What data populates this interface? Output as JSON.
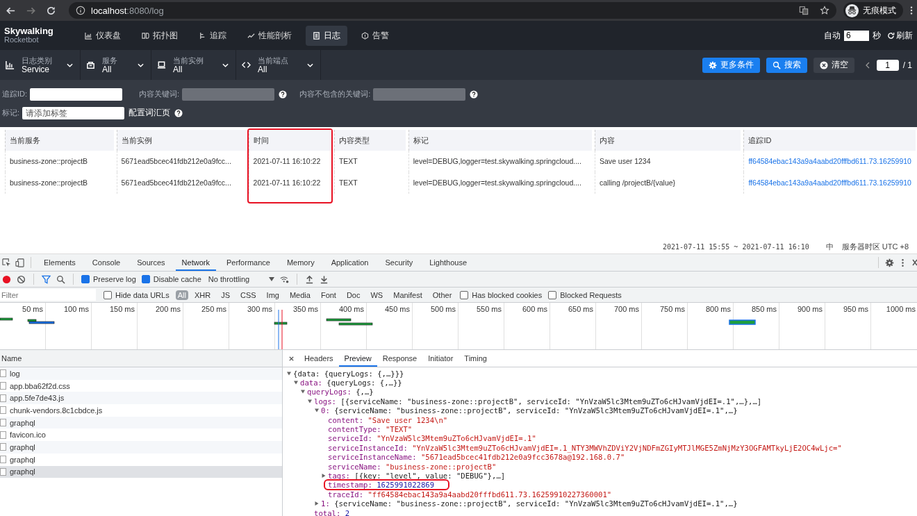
{
  "browser": {
    "url_host": "localhost",
    "url_path": ":8080/log",
    "profile": "无痕模式"
  },
  "app": {
    "logo": "Skywalking",
    "logo_sub": "Rocketbot",
    "nav": [
      {
        "label": "仪表盘",
        "selected": false
      },
      {
        "label": "拓扑图",
        "selected": false
      },
      {
        "label": "追踪",
        "selected": false
      },
      {
        "label": "性能剖析",
        "selected": false
      },
      {
        "label": "日志",
        "selected": true
      },
      {
        "label": "告警",
        "selected": false
      }
    ],
    "auto_label": "自动",
    "interval": "6",
    "interval_unit": "秒",
    "refresh": "刷新"
  },
  "toolbar": {
    "selectors": [
      {
        "label": "日志类别",
        "value": "Service"
      },
      {
        "label": "服务",
        "value": "All"
      },
      {
        "label": "当前实例",
        "value": "All"
      },
      {
        "label": "当前端点",
        "value": "All"
      }
    ],
    "buttons": [
      {
        "label": "更多条件",
        "kind": "primary"
      },
      {
        "label": "搜索",
        "kind": "primary"
      },
      {
        "label": "清空",
        "kind": "secondary"
      }
    ],
    "page": "1",
    "page_total": "/ 1"
  },
  "filters": {
    "fields": [
      {
        "label": "追踪ID:",
        "disabled": false,
        "help": false
      },
      {
        "label": "内容关键词:",
        "disabled": true,
        "help": true
      },
      {
        "label": "内容不包含的关键词:",
        "disabled": true,
        "help": true
      }
    ],
    "tags": {
      "label": "标记:",
      "placeholder": "请添加标签"
    },
    "vocab_link": "配置词汇页"
  },
  "table": {
    "columns": [
      {
        "label": "当前服务",
        "kind": "text",
        "highlighted": false
      },
      {
        "label": "当前实例",
        "kind": "text",
        "highlighted": false
      },
      {
        "label": "时间",
        "kind": "text",
        "highlighted": true
      },
      {
        "label": "内容类型",
        "kind": "text",
        "highlighted": false
      },
      {
        "label": "标记",
        "kind": "text",
        "highlighted": false
      },
      {
        "label": "内容",
        "kind": "text",
        "highlighted": false
      },
      {
        "label": "追踪ID",
        "kind": "link",
        "highlighted": false
      }
    ],
    "rows": [
      [
        "business-zone::projectB",
        "5671ead5bcec41fdb212e0a9fcc...",
        "2021-07-11 16:10:22",
        "TEXT",
        "level=DEBUG,logger=test.skywalking.springcloud....",
        "Save user 1234",
        "ff64584ebac143a9a4aabd20fffbd611.73.16259910"
      ],
      [
        "business-zone::projectB",
        "5671ead5bcec41fdb212e0a9fcc...",
        "2021-07-11 16:10:22",
        "TEXT",
        "level=DEBUG,logger=test.skywalking.springcloud....",
        "calling /projectB/{value}",
        "ff64584ebac143a9a4aabd20fffbd611.73.16259910"
      ]
    ]
  },
  "footer": {
    "time_range": "2021-07-11 15:55 ~ 2021-07-11 16:10",
    "language": "中",
    "timezone": "服务器时区 UTC +8"
  },
  "devtools": {
    "tabs": [
      {
        "label": "Elements",
        "selected": false
      },
      {
        "label": "Console",
        "selected": false
      },
      {
        "label": "Sources",
        "selected": false
      },
      {
        "label": "Network",
        "selected": true
      },
      {
        "label": "Performance",
        "selected": false
      },
      {
        "label": "Memory",
        "selected": false
      },
      {
        "label": "Application",
        "selected": false
      },
      {
        "label": "Security",
        "selected": false
      },
      {
        "label": "Lighthouse",
        "selected": false
      }
    ],
    "options": [
      {
        "label": "Preserve log",
        "checked": true
      },
      {
        "label": "Disable cache",
        "checked": true
      }
    ],
    "throttling": "No throttling",
    "filter_placeholder": "Filter",
    "hide_data_urls": {
      "label": "Hide data URLs",
      "checked": false
    },
    "types": [
      {
        "label": "All",
        "selected": true
      },
      {
        "label": "XHR",
        "selected": false
      },
      {
        "label": "JS",
        "selected": false
      },
      {
        "label": "CSS",
        "selected": false
      },
      {
        "label": "Img",
        "selected": false
      },
      {
        "label": "Media",
        "selected": false
      },
      {
        "label": "Font",
        "selected": false
      },
      {
        "label": "Doc",
        "selected": false
      },
      {
        "label": "WS",
        "selected": false
      },
      {
        "label": "Manifest",
        "selected": false
      },
      {
        "label": "Other",
        "selected": false
      }
    ],
    "blocked": [
      {
        "label": "Has blocked cookies",
        "checked": false
      },
      {
        "label": "Blocked Requests",
        "checked": false
      }
    ],
    "ticks": [
      "50 ms",
      "100 ms",
      "150 ms",
      "200 ms",
      "250 ms",
      "300 ms",
      "350 ms",
      "400 ms",
      "450 ms",
      "500 ms",
      "550 ms",
      "600 ms",
      "650 ms",
      "700 ms",
      "750 ms",
      "800 ms",
      "850 ms",
      "900 ms",
      "950 ms",
      "1000 ms"
    ],
    "name_header": "Name",
    "requests": [
      {
        "name": "log",
        "selected": false
      },
      {
        "name": "app.bba62f2d.css",
        "selected": false
      },
      {
        "name": "app.5fe7de43.js",
        "selected": false
      },
      {
        "name": "chunk-vendors.8c1cbdce.js",
        "selected": false
      },
      {
        "name": "graphql",
        "selected": false
      },
      {
        "name": "favicon.ico",
        "selected": false
      },
      {
        "name": "graphql",
        "selected": false
      },
      {
        "name": "graphql",
        "selected": false
      },
      {
        "name": "graphql",
        "selected": true
      }
    ],
    "preview": {
      "tabs": [
        {
          "label": "Headers",
          "selected": false
        },
        {
          "label": "Preview",
          "selected": true
        },
        {
          "label": "Response",
          "selected": false
        },
        {
          "label": "Initiator",
          "selected": false
        },
        {
          "label": "Timing",
          "selected": false
        }
      ],
      "tree": [
        {
          "value": "{data: {queryLogs: {,…}}}",
          "kind": "object",
          "expanded": true,
          "highlighted": false,
          "children": [
            {
              "key": "data:",
              "value": "{queryLogs: {,…}}",
              "kind": "object",
              "expanded": true,
              "highlighted": false,
              "children": [
                {
                  "key": "queryLogs:",
                  "value": "{,…}",
                  "kind": "object",
                  "expanded": true,
                  "highlighted": false,
                  "children": [
                    {
                      "key": "logs:",
                      "value": "[{serviceName: \"business-zone::projectB\", serviceId: \"YnVzaW5lc3Mtem9uZTo6cHJvamVjdEI=.1\",…},…]",
                      "kind": "object",
                      "expanded": true,
                      "highlighted": false,
                      "children": [
                        {
                          "key": "0:",
                          "value": "{serviceName: \"business-zone::projectB\", serviceId: \"YnVzaW5lc3Mtem9uZTo6cHJvamVjdEI=.1\",…}",
                          "kind": "object",
                          "expanded": true,
                          "highlighted": false,
                          "children": [
                            {
                              "key": "content:",
                              "value": "\"Save user 1234\\n\"",
                              "kind": "string",
                              "highlighted": false
                            },
                            {
                              "key": "contentType:",
                              "value": "\"TEXT\"",
                              "kind": "string",
                              "highlighted": false
                            },
                            {
                              "key": "serviceId:",
                              "value": "\"YnVzaW5lc3Mtem9uZTo6cHJvamVjdEI=.1\"",
                              "kind": "string",
                              "highlighted": false
                            },
                            {
                              "key": "serviceInstanceId:",
                              "value": "\"YnVzaW5lc3Mtem9uZTo6cHJvamVjdEI=.1_NTY3MWVhZDViY2VjNDFmZGIyMTJlMGE5ZmNjMzY3OGFAMTkyLjE2OC4wLjc=\"",
                              "kind": "string",
                              "highlighted": false
                            },
                            {
                              "key": "serviceInstanceName:",
                              "value": "\"5671ead5bcec41fdb212e0a9fcc3678a@192.168.0.7\"",
                              "kind": "string",
                              "highlighted": false
                            },
                            {
                              "key": "serviceName:",
                              "value": "\"business-zone::projectB\"",
                              "kind": "string",
                              "highlighted": false
                            },
                            {
                              "key": "tags:",
                              "value": "[{key: \"level\", value: \"DEBUG\"},…]",
                              "kind": "object",
                              "expanded": false,
                              "highlighted": false
                            },
                            {
                              "key": "timestamp:",
                              "value": "1625991022869",
                              "kind": "number",
                              "highlighted": true
                            },
                            {
                              "key": "traceId:",
                              "value": "\"ff64584ebac143a9a4aabd20fffbd611.73.16259910227360001\"",
                              "kind": "string",
                              "highlighted": false
                            }
                          ]
                        },
                        {
                          "key": "1:",
                          "value": "{serviceName: \"business-zone::projectB\", serviceId: \"YnVzaW5lc3Mtem9uZTo6cHJvamVjdEI=.1\",…}",
                          "kind": "object",
                          "expanded": false,
                          "highlighted": false
                        }
                      ]
                    },
                    {
                      "key": "total:",
                      "value": "2",
                      "kind": "number",
                      "highlighted": false
                    }
                  ]
                }
              ]
            }
          ]
        }
      ]
    }
  }
}
